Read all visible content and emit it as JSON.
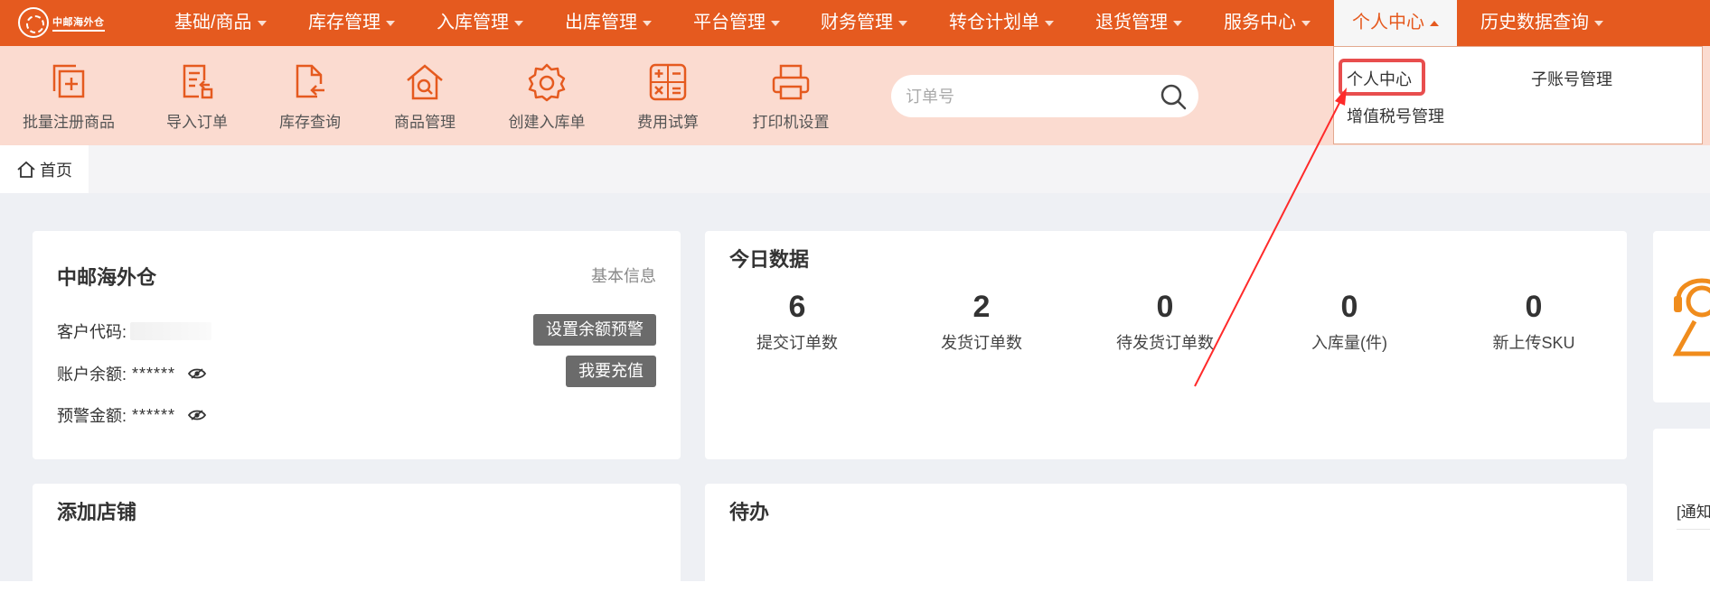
{
  "brand": {
    "logo_text": "中邮海外仓",
    "accent": "#e55a1f",
    "toolbar_bg": "#fbdbd0"
  },
  "nav": {
    "items": [
      {
        "label": "基础/商品",
        "has_caret": true
      },
      {
        "label": "库存管理",
        "has_caret": true
      },
      {
        "label": "入库管理",
        "has_caret": true
      },
      {
        "label": "出库管理",
        "has_caret": true
      },
      {
        "label": "平台管理",
        "has_caret": true
      },
      {
        "label": "财务管理",
        "has_caret": true
      },
      {
        "label": "转仓计划单",
        "has_caret": true
      },
      {
        "label": "退货管理",
        "has_caret": true
      },
      {
        "label": "服务中心",
        "has_caret": true
      },
      {
        "label": "个人中心",
        "has_caret": true,
        "active": true
      },
      {
        "label": "历史数据查询",
        "has_caret": true
      }
    ]
  },
  "toolbar": {
    "items": [
      {
        "label": "批量注册商品",
        "icon": "batch-register-icon"
      },
      {
        "label": "导入订单",
        "icon": "import-order-icon"
      },
      {
        "label": "库存查询",
        "icon": "inventory-query-icon"
      },
      {
        "label": "商品管理",
        "icon": "product-manage-icon"
      },
      {
        "label": "创建入库单",
        "icon": "gear-icon"
      },
      {
        "label": "费用试算",
        "icon": "calculator-icon"
      },
      {
        "label": "打印机设置",
        "icon": "printer-icon"
      }
    ],
    "search_placeholder": "订单号",
    "search_value": ""
  },
  "tabs": {
    "home_label": "首页"
  },
  "dropdown": {
    "items": [
      "个人中心",
      "子账号管理",
      "增值税号管理"
    ],
    "highlighted": "个人中心",
    "highlight_color": "#e84e4e"
  },
  "account_card": {
    "title": "中邮海外仓",
    "basic_info_link": "基本信息",
    "customer_code_label": "客户代码:",
    "balance_label": "账户余额:",
    "balance_value": "******",
    "warning_label": "预警金额:",
    "warning_value": "******",
    "set_warning_button": "设置余额预警",
    "recharge_button": "我要充值"
  },
  "today_card": {
    "title": "今日数据",
    "stats": [
      {
        "value": "6",
        "label": "提交订单数"
      },
      {
        "value": "2",
        "label": "发货订单数"
      },
      {
        "value": "0",
        "label": "待发货订单数"
      },
      {
        "value": "0",
        "label": "入库量(件)"
      },
      {
        "value": "0",
        "label": "新上传SKU"
      }
    ]
  },
  "add_store_card": {
    "title": "添加店铺"
  },
  "todo_card": {
    "title": "待办"
  },
  "side_card": {
    "notice_text": "[通知"
  }
}
